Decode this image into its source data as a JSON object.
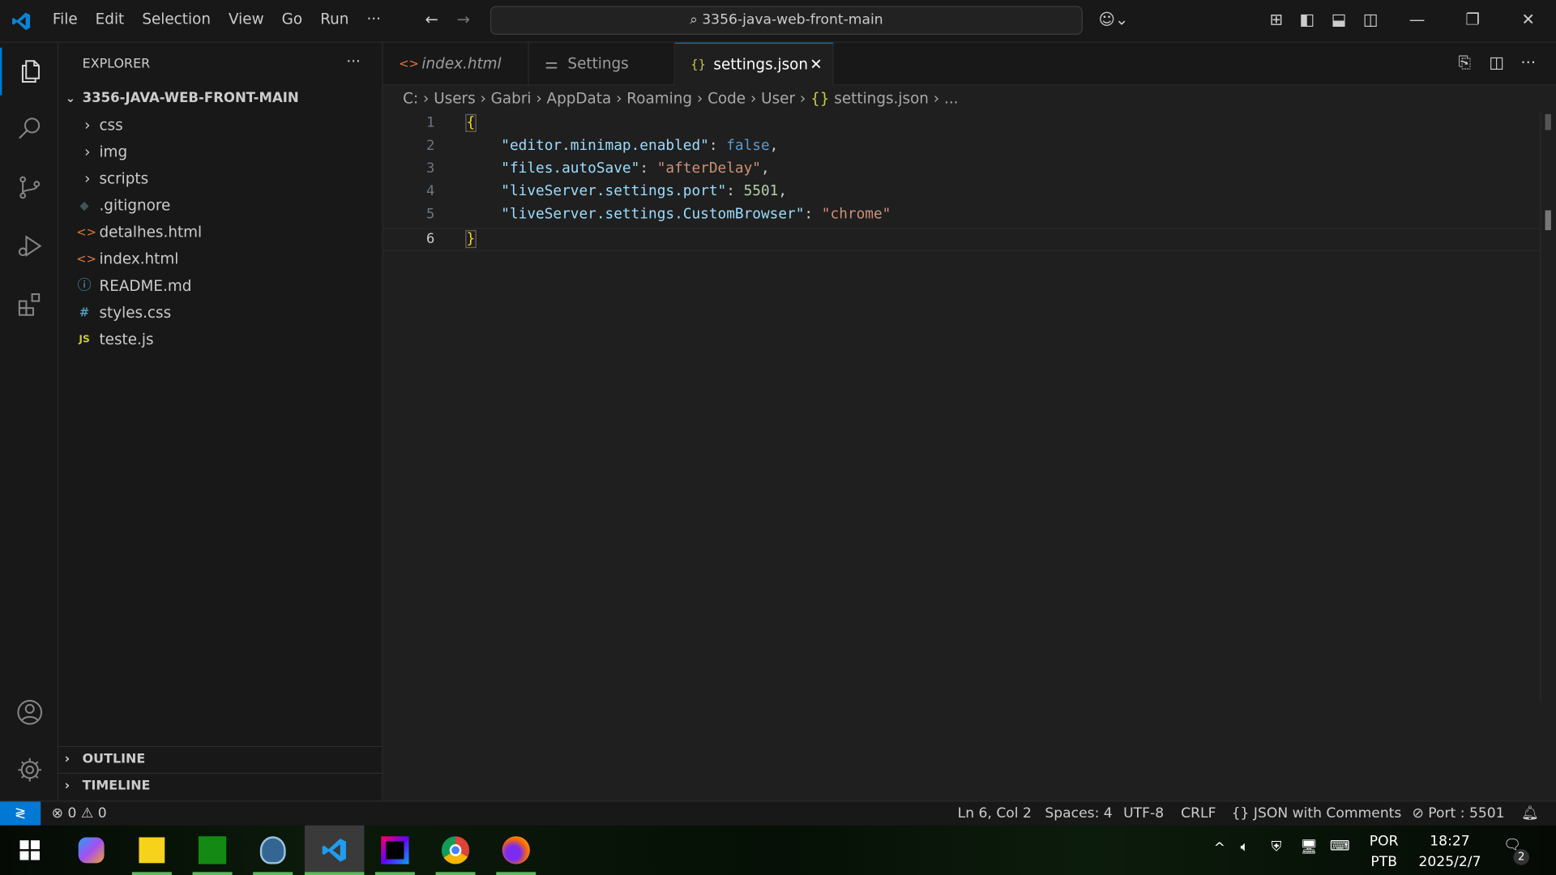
{
  "titlebar": {
    "menu": [
      "File",
      "Edit",
      "Selection",
      "View",
      "Go",
      "Run",
      "···"
    ],
    "search": "3356-java-web-front-main"
  },
  "sidebar": {
    "title": "EXPLORER",
    "more": "···",
    "root": "3356-JAVA-WEB-FRONT-MAIN",
    "items": [
      {
        "label": "css",
        "type": "folder",
        "icon": "›"
      },
      {
        "label": "img",
        "type": "folder",
        "icon": "›"
      },
      {
        "label": "scripts",
        "type": "folder",
        "icon": "›"
      },
      {
        "label": ".gitignore",
        "type": "file",
        "icon": "◆"
      },
      {
        "label": "detalhes.html",
        "type": "file",
        "icon": "<>"
      },
      {
        "label": "index.html",
        "type": "file",
        "icon": "<>"
      },
      {
        "label": "README.md",
        "type": "file",
        "icon": "ⓘ"
      },
      {
        "label": "styles.css",
        "type": "file",
        "icon": "#"
      },
      {
        "label": "teste.js",
        "type": "file",
        "icon": "JS"
      }
    ],
    "outline": "OUTLINE",
    "timeline": "TIMELINE"
  },
  "tabs": [
    {
      "label": "index.html",
      "icon": "<>"
    },
    {
      "label": "Settings",
      "icon": "⚌"
    },
    {
      "label": "settings.json",
      "icon": "{}",
      "close": "✕"
    }
  ],
  "breadcrumb": [
    "C:",
    "Users",
    "Gabri",
    "AppData",
    "Roaming",
    "Code",
    "User",
    "settings.json",
    "..."
  ],
  "editor": {
    "line_numbers": [
      "1",
      "2",
      "3",
      "4",
      "5",
      "6"
    ],
    "lines": {
      "l1": "{",
      "l2k": "\"editor.minimap.enabled\"",
      "l2v": "false",
      "l3k": "\"files.autoSave\"",
      "l3v": "\"afterDelay\"",
      "l4k": "\"liveServer.settings.port\"",
      "l4v": "5501",
      "l5k": "\"liveServer.settings.CustomBrowser\"",
      "l5v": "\"chrome\"",
      "l6": "}"
    }
  },
  "status": {
    "errors": "0",
    "warnings": "0",
    "position": "Ln 6, Col 2",
    "spaces": "Spaces: 4",
    "encoding": "UTF-8",
    "eol": "CRLF",
    "language": "JSON with Comments",
    "port": "Port : 5501"
  },
  "taskbar": {
    "lang1": "POR",
    "lang2": "PTB",
    "time": "18:27",
    "date": "2025/2/7",
    "notifications": "2"
  },
  "colors": {
    "accent": "#0078d4",
    "key": "#9cdcfe",
    "string": "#ce9178",
    "keyword": "#569cd6",
    "number": "#b5cea8",
    "bracket": "#ffd700"
  }
}
